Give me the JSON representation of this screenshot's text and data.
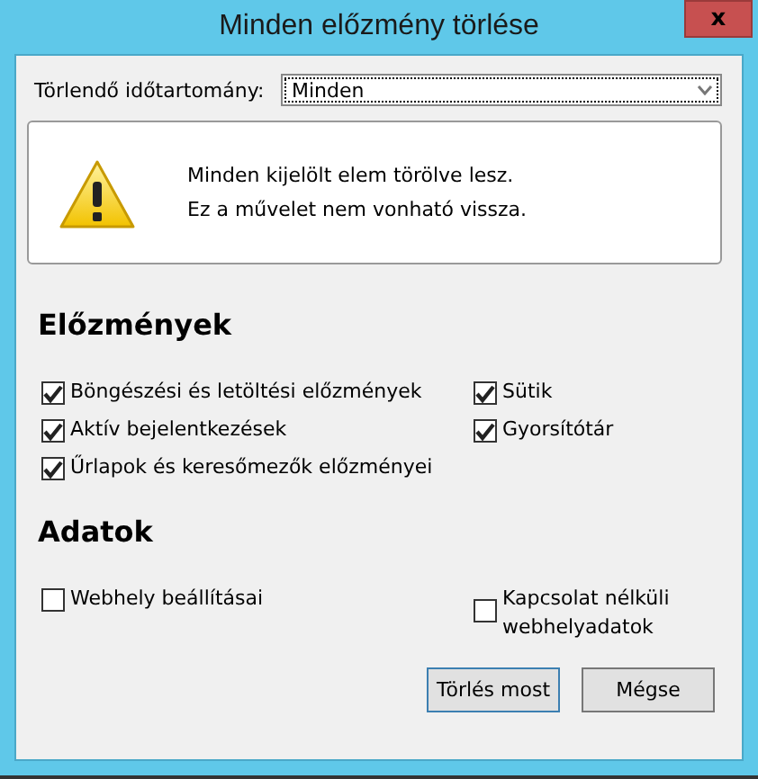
{
  "window": {
    "title": "Minden előzmény törlése",
    "close": "x"
  },
  "range": {
    "label": "Törlendő időtartomány:",
    "value": "Minden"
  },
  "warning": {
    "lines": [
      "Minden kijelölt elem törölve lesz.",
      "Ez a művelet nem vonható vissza."
    ]
  },
  "sections": [
    {
      "heading": "Előzmények",
      "left": [
        {
          "label": "Böngészési és letöltési előzmények",
          "checked": true
        },
        {
          "label": "Aktív bejelentkezések",
          "checked": true
        },
        {
          "label": "Űrlapok és keresőmezők előzményei",
          "checked": true
        }
      ],
      "right": [
        {
          "label": "Sütik",
          "checked": true
        },
        {
          "label": "Gyorsítótár",
          "checked": true
        }
      ]
    },
    {
      "heading": "Adatok",
      "left": [
        {
          "label": "Webhely beállításai",
          "checked": false
        }
      ],
      "right": [
        {
          "label": "Kapcsolat nélküli webhelyadatok",
          "checked": false
        }
      ]
    }
  ],
  "buttons": [
    {
      "label": "Törlés most",
      "default": true
    },
    {
      "label": "Mégse",
      "default": false
    }
  ]
}
